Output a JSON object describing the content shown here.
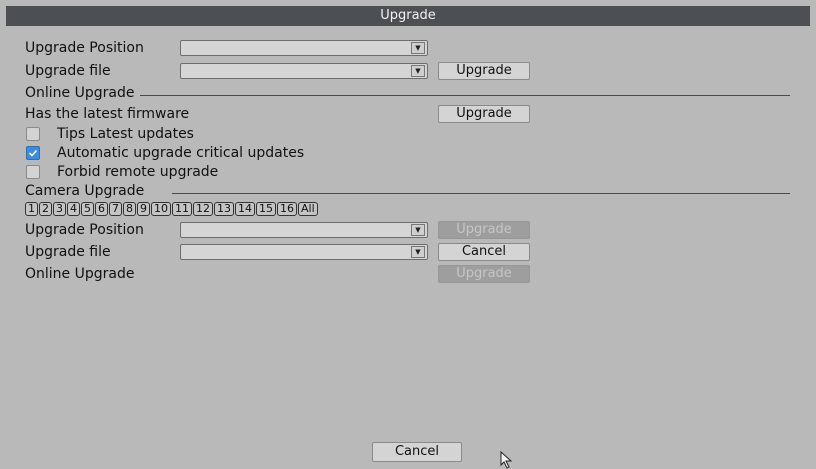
{
  "window": {
    "title": "Upgrade"
  },
  "local": {
    "position_label": "Upgrade Position",
    "file_label": "Upgrade file",
    "upgrade_button": "Upgrade"
  },
  "online": {
    "section_title": "Online Upgrade",
    "firmware_status": "Has the latest firmware",
    "upgrade_button": "Upgrade",
    "options": [
      {
        "label": "Tips Latest updates",
        "checked": false
      },
      {
        "label": "Automatic upgrade critical updates",
        "checked": true
      },
      {
        "label": "Forbid remote upgrade",
        "checked": false
      }
    ]
  },
  "camera": {
    "section_title": "Camera Upgrade",
    "channels": [
      "1",
      "2",
      "3",
      "4",
      "5",
      "6",
      "7",
      "8",
      "9",
      "10",
      "11",
      "12",
      "13",
      "14",
      "15",
      "16",
      "All"
    ],
    "position_label": "Upgrade Position",
    "file_label": "Upgrade file",
    "online_label": "Online Upgrade",
    "upgrade_button": "Upgrade",
    "cancel_button": "Cancel",
    "online_upgrade_button": "Upgrade"
  },
  "footer": {
    "cancel_button": "Cancel"
  },
  "colors": {
    "titlebar": "#4d4f53",
    "background": "#b9b9b9",
    "checkbox_checked": "#3a8ee0"
  }
}
